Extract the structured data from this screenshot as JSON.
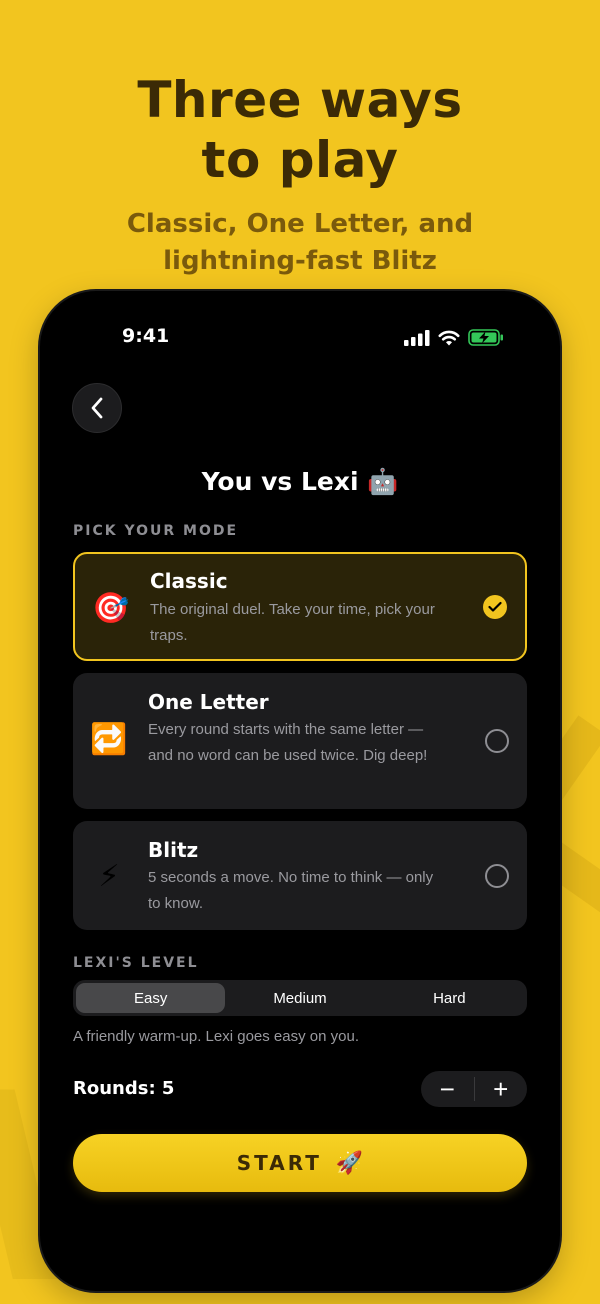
{
  "promo": {
    "headline_line1": "Three ways",
    "headline_line2": "to play",
    "subhead_line1": "Classic, One Letter, and",
    "subhead_line2": "lightning-fast Blitz"
  },
  "status_bar": {
    "time": "9:41",
    "icons": [
      "signal-icon",
      "wifi-icon",
      "battery-charging-icon"
    ]
  },
  "screen": {
    "title": "You vs Lexi 🤖",
    "back_icon": "chevron-left-icon"
  },
  "modes": {
    "section_label": "PICK YOUR MODE",
    "items": [
      {
        "emoji": "🎯",
        "title": "Classic",
        "desc": "The original duel. Take your time, pick your traps.",
        "selected": true
      },
      {
        "emoji": "🔁",
        "title": "One Letter",
        "desc": "Every round starts with the same letter — and no word can be used twice. Dig deep!",
        "selected": false
      },
      {
        "emoji": "⚡",
        "title": "Blitz",
        "desc": "5 seconds a move. No time to think — only to know.",
        "selected": false
      }
    ]
  },
  "level": {
    "section_label": "LEXI'S LEVEL",
    "options": [
      "Easy",
      "Medium",
      "Hard"
    ],
    "selected": "Easy",
    "description": "A friendly warm-up. Lexi goes easy on you."
  },
  "rounds": {
    "label": "Rounds: 5",
    "minus": "−",
    "plus": "+"
  },
  "start": {
    "label": "START",
    "emoji": "🚀"
  },
  "colors": {
    "accent": "#f2c51f",
    "background": "#f2c51f",
    "card": "#1c1c1e",
    "selected_card": "#2a2308"
  }
}
